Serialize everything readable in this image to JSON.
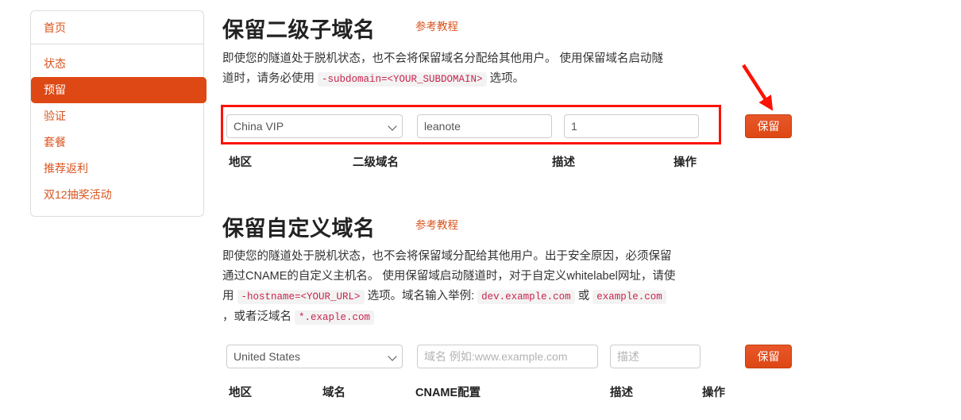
{
  "sidebar": {
    "home": {
      "label": "首页"
    },
    "items": [
      {
        "label": "状态",
        "active": false
      },
      {
        "label": "预留",
        "active": true
      },
      {
        "label": "验证",
        "active": false
      },
      {
        "label": "套餐",
        "active": false
      },
      {
        "label": "推荐返利",
        "active": false
      },
      {
        "label": "双12抽奖活动",
        "active": false
      }
    ]
  },
  "section_subdomain": {
    "title": "保留二级子域名",
    "tutorial_link": "参考教程",
    "desc_part1": "即使您的隧道处于脱机状态，也不会将保留域名分配给其他用户。 使用保留域名启动隧道时，请务必使用",
    "code_subdomain": "-subdomain=<YOUR_SUBDOMAIN>",
    "desc_part2": "选项。",
    "form": {
      "region_value": "China VIP",
      "region_options": [
        "China VIP",
        "United States"
      ],
      "subdomain_value": "leanote",
      "subdomain_placeholder": "",
      "description_value": "1",
      "description_placeholder": "",
      "save_label": "保留"
    },
    "table_headers": [
      "地区",
      "二级域名",
      "描述",
      "操作"
    ]
  },
  "section_custom": {
    "title": "保留自定义域名",
    "tutorial_link": "参考教程",
    "desc_part1": "即使您的隧道处于脱机状态，也不会将保留域分配给其他用户。出于安全原因，必须保留通过CNAME的自定义主机名。 使用保留域启动隧道时，对于自定义whitelabel网址，请使用",
    "code_hostname": "-hostname=<YOUR_URL>",
    "desc_part2": "选项。域名输入举例:",
    "code_dev_example": "dev.example.com",
    "desc_or": "或",
    "code_example": "example.com",
    "desc_part3": "，或者泛域名",
    "code_wildcard": "*.exaple.com",
    "form": {
      "region_value": "United States",
      "region_options": [
        "United States",
        "China VIP"
      ],
      "domain_value": "",
      "domain_placeholder": "域名 例如:www.example.com",
      "description_value": "",
      "description_placeholder": "描述",
      "save_label": "保留"
    },
    "table_headers": [
      "地区",
      "域名",
      "CNAME配置",
      "描述",
      "操作"
    ]
  },
  "annotations": {
    "highlight_color": "#fc1205",
    "arrow_color": "#fc1205",
    "accent_color": "#dd4814",
    "link_color": "#d9541e",
    "code_color": "#c7254e"
  }
}
